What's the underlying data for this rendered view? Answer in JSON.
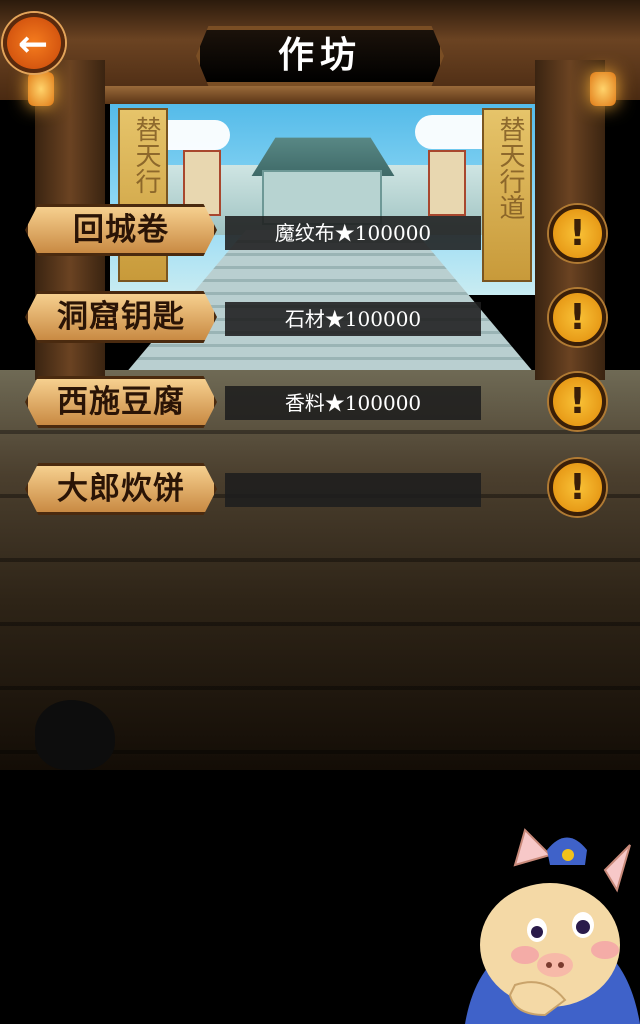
{
  "header": {
    "title": "作坊"
  },
  "back_button": {
    "icon": "back-arrow-icon",
    "glyph": "←"
  },
  "recipes": [
    {
      "name": "回城卷",
      "material": "魔纹布★100000"
    },
    {
      "name": "洞窟钥匙",
      "material": "石材★100000"
    },
    {
      "name": "西施豆腐",
      "material": "香料★100000"
    },
    {
      "name": "大郎炊饼",
      "material": ""
    }
  ],
  "info_glyph": "!",
  "banners": {
    "left": "替天行",
    "right": "替天行道"
  },
  "colors": {
    "button_gold": "#e8b66a",
    "info_orange": "#f0a21e",
    "title_plate": "#000000",
    "back_orange": "#e8641a"
  }
}
